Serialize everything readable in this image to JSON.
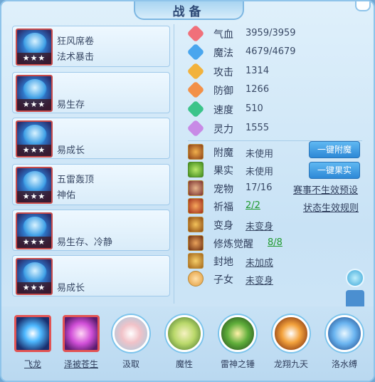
{
  "window": {
    "title": "战备"
  },
  "equipment": [
    {
      "line1": "狂风席卷",
      "line2": "法术暴击",
      "stars": "★★★"
    },
    {
      "line1": "易生存",
      "line2": "",
      "stars": "★★★"
    },
    {
      "line1": "易成长",
      "line2": "",
      "stars": "★★★"
    },
    {
      "line1": "五雷轰顶",
      "line2": "神佑",
      "stars": "★★★"
    },
    {
      "line1": "易生存、冷静",
      "line2": "",
      "stars": "★★★"
    },
    {
      "line1": "易成长",
      "line2": "",
      "stars": "★★★"
    }
  ],
  "stats": [
    {
      "label": "气血",
      "value": "3959/3959",
      "icon": "heart-icon",
      "color": "#f0707a"
    },
    {
      "label": "魔法",
      "value": "4679/4679",
      "icon": "mana-icon",
      "color": "#4aa6ee"
    },
    {
      "label": "攻击",
      "value": "1314",
      "icon": "sword-icon",
      "color": "#f2b23c"
    },
    {
      "label": "防御",
      "value": "1266",
      "icon": "shield-icon",
      "color": "#f29048"
    },
    {
      "label": "速度",
      "value": "510",
      "icon": "speed-icon",
      "color": "#3bc48a"
    },
    {
      "label": "灵力",
      "value": "1555",
      "icon": "spirit-icon",
      "color": "#c88ae6"
    }
  ],
  "extras": {
    "enchant": {
      "label": "附魔",
      "value": "未使用",
      "button": "一键附魔"
    },
    "fruit": {
      "label": "果实",
      "value": "未使用",
      "button": "一键果实"
    },
    "pet": {
      "label": "宠物",
      "value": "17/16",
      "link": "赛事不生效预设"
    },
    "blessing": {
      "label": "祈福",
      "value": "2/2",
      "link": "状态生效规则"
    },
    "transform": {
      "label": "变身",
      "value": "未变身"
    },
    "cultivation": {
      "label": "修炼觉醒",
      "value": "8/8"
    },
    "territory": {
      "label": "封地",
      "value": "未加成"
    },
    "child": {
      "label": "子女",
      "value": "未变身"
    }
  },
  "skills": [
    {
      "label": "飞龙",
      "color": "#4db8ff"
    },
    {
      "label": "泽被苍生",
      "color": "#d14fd8"
    },
    {
      "label": "汲取",
      "color": "#e7eef6"
    },
    {
      "label": "魔性",
      "color": "#b9d86a"
    },
    {
      "label": "雷神之锤",
      "color": "#5fae3a"
    },
    {
      "label": "龙翔九天",
      "color": "#f3a23c"
    },
    {
      "label": "洛水缚",
      "color": "#6ab4f0"
    }
  ]
}
